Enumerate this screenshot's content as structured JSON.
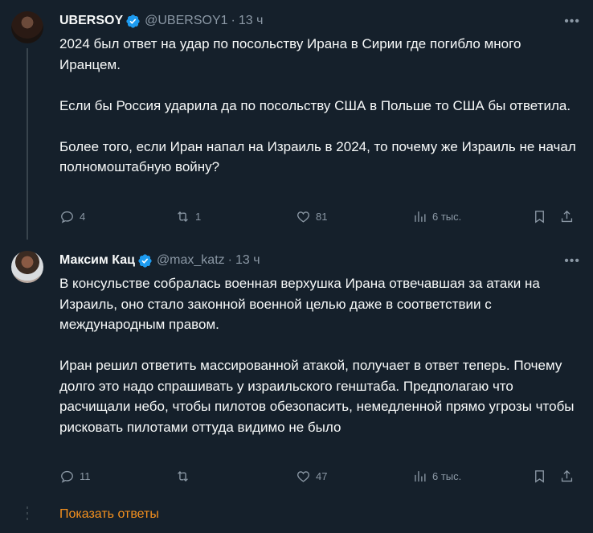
{
  "tweets": [
    {
      "name": "UBERSOY",
      "handle": "@UBERSOY1",
      "time": "13 ч",
      "text": "2024 был ответ на удар по посольству Ирана в Сирии где погибло много Иранцем.\n\nЕсли бы Россия ударила да по посольству США в Польше то США бы ответила.\n\nБолее того, если Иран напал на Израиль в 2024, то почему же Израиль не начал полномоштабную войну?",
      "replies": "4",
      "retweets": "1",
      "likes": "81",
      "views": "6 тыс."
    },
    {
      "name": "Максим Кац",
      "handle": "@max_katz",
      "time": "13 ч",
      "text": "В консульстве собралась военная верхушка Ирана отвечавшая за атаки на Израиль, оно стало законной военной целью даже в соответствии с международным правом.\n\nИран решил ответить массированной атакой, получает в ответ теперь. Почему долго это надо спрашивать у израильского генштаба. Предполагаю что расчищали небо, чтобы пилотов обезопасить, немедленной прямо угрозы чтобы рисковать пилотами оттуда видимо не было",
      "replies": "11",
      "retweets": "",
      "likes": "47",
      "views": "6 тыс."
    }
  ],
  "show_replies_label": "Показать ответы",
  "separator": "·",
  "colors": {
    "background": "#15202b",
    "text": "#f7f9f9",
    "muted": "#8b98a5",
    "verified": "#1d9bf0",
    "link": "#f4901e"
  },
  "icons": [
    "reply-icon",
    "retweet-icon",
    "like-icon",
    "views-icon",
    "bookmark-icon",
    "share-icon",
    "verified-icon",
    "more-icon"
  ]
}
